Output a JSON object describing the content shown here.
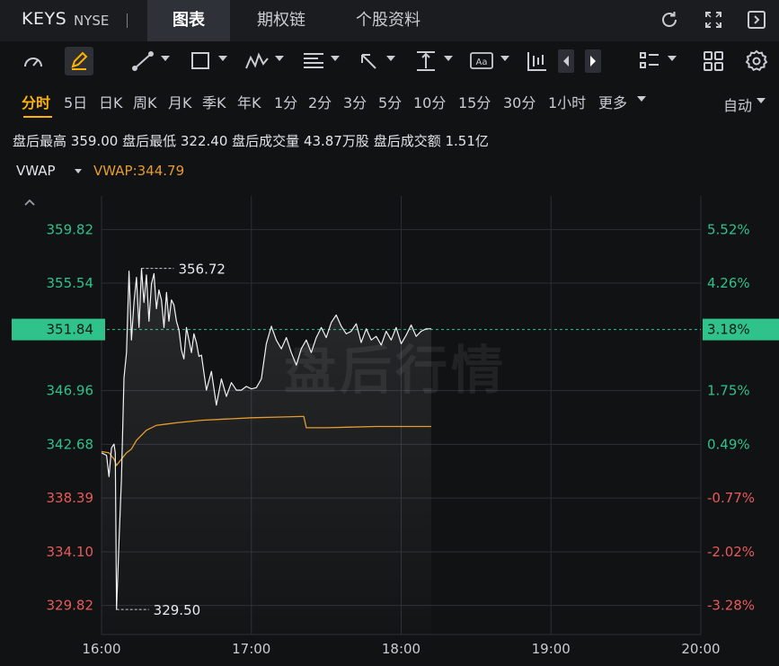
{
  "header": {
    "ticker": "KEYS",
    "exchange": "NYSE",
    "tabs": [
      {
        "label": "图表",
        "active": true
      },
      {
        "label": "期权链",
        "active": false
      },
      {
        "label": "个股资料",
        "active": false
      }
    ]
  },
  "periods": {
    "items": [
      "分时",
      "5日",
      "日K",
      "周K",
      "月K",
      "季K",
      "年K",
      "1分",
      "2分",
      "3分",
      "5分",
      "10分",
      "15分",
      "30分",
      "1小时",
      "更多"
    ],
    "active": "分时",
    "mode": "自动"
  },
  "stats": {
    "high_label": "盘后最高",
    "high": "359.00",
    "low_label": "盘后最低",
    "low": "322.40",
    "volume_label": "盘后成交量",
    "volume": "43.87万股",
    "amount_label": "盘后成交额",
    "amount": "1.51亿"
  },
  "indicator": {
    "name": "VWAP",
    "value_text": "VWAP:344.79"
  },
  "watermark": "盘后行情",
  "colors": {
    "up": "#2fc28b",
    "down": "#e85a5a",
    "vwap": "#e69b2e",
    "price_line": "#f2f2f2",
    "accent": "#ffb300"
  },
  "chart_data": {
    "type": "line",
    "x_ticks": [
      "16:00",
      "17:00",
      "18:00",
      "19:00",
      "20:00"
    ],
    "price_ticks": [
      "359.82",
      "355.54",
      "351.84",
      "346.96",
      "342.68",
      "338.39",
      "334.10",
      "329.82"
    ],
    "price_tick_values": [
      359.82,
      355.54,
      351.84,
      346.96,
      342.68,
      338.39,
      334.1,
      329.82
    ],
    "pct_ticks": [
      "5.52%",
      "4.26%",
      "3.18%",
      "1.75%",
      "0.49%",
      "-0.77%",
      "-2.02%",
      "-3.28%"
    ],
    "ylim": [
      327.5,
      362.5
    ],
    "xlim_minutes": [
      0,
      240
    ],
    "reference_price": 340.99,
    "current_price": 351.84,
    "current_pct": "3.18%",
    "max_marker": {
      "label": "356.72",
      "value": 356.72,
      "t": 16
    },
    "min_marker": {
      "label": "329.50",
      "value": 329.5,
      "t": 6
    },
    "series": [
      {
        "role": "price",
        "t": [
          0,
          2,
          3,
          4,
          5,
          5.5,
          6,
          7,
          8,
          9,
          10,
          11,
          12,
          13,
          14,
          15,
          16,
          17,
          18,
          19,
          20,
          21,
          22,
          23,
          24,
          25,
          26,
          27,
          28,
          29,
          30,
          31,
          32,
          33,
          34,
          35,
          36,
          37,
          38,
          39,
          40,
          42,
          44,
          46,
          48,
          50,
          52,
          54,
          56,
          58,
          60,
          62,
          64,
          66,
          68,
          70,
          72,
          74,
          76,
          78,
          80,
          82,
          84,
          86,
          88,
          90,
          92,
          94,
          96,
          98,
          100,
          102,
          104,
          106,
          108,
          110,
          112,
          114,
          116,
          118,
          120,
          122,
          124,
          126,
          128,
          130,
          132
        ],
        "values": [
          342.0,
          341.8,
          340.1,
          342.4,
          342.7,
          342.0,
          329.5,
          335.0,
          340.0,
          348.0,
          350.0,
          356.5,
          351.0,
          354.0,
          356.0,
          352.0,
          356.7,
          354.0,
          356.2,
          352.5,
          355.5,
          356.3,
          353.5,
          355.0,
          354.2,
          352.0,
          354.8,
          352.5,
          354.2,
          353.8,
          352.5,
          351.8,
          350.2,
          349.5,
          352.0,
          351.0,
          350.0,
          351.5,
          350.8,
          349.7,
          349.8,
          347.0,
          348.5,
          345.8,
          347.9,
          346.5,
          347.6,
          347.0,
          347.0,
          347.3,
          347.1,
          347.2,
          347.9,
          350.7,
          352.1,
          351.0,
          350.3,
          351.2,
          350.0,
          349.0,
          350.3,
          351.0,
          350.0,
          351.2,
          352.0,
          351.2,
          352.4,
          353.0,
          352.1,
          351.5,
          351.7,
          352.3,
          350.8,
          351.9,
          351.0,
          351.3,
          350.6,
          351.7,
          351.0,
          352.0,
          350.7,
          351.4,
          352.2,
          351.3,
          351.7,
          351.9,
          351.9
        ]
      },
      {
        "role": "vwap",
        "name": "VWAP",
        "t": [
          0,
          3,
          5,
          6,
          8,
          10,
          12,
          14,
          18,
          22,
          26,
          30,
          40,
          50,
          60,
          70,
          80,
          81,
          82,
          90,
          100,
          110,
          120,
          130,
          132
        ],
        "values": [
          342.1,
          342.0,
          341.5,
          341.0,
          341.5,
          342.0,
          342.3,
          343.0,
          343.8,
          344.2,
          344.3,
          344.4,
          344.6,
          344.7,
          344.8,
          344.85,
          344.9,
          344.9,
          344.0,
          344.0,
          344.05,
          344.1,
          344.1,
          344.1,
          344.1
        ]
      }
    ]
  }
}
